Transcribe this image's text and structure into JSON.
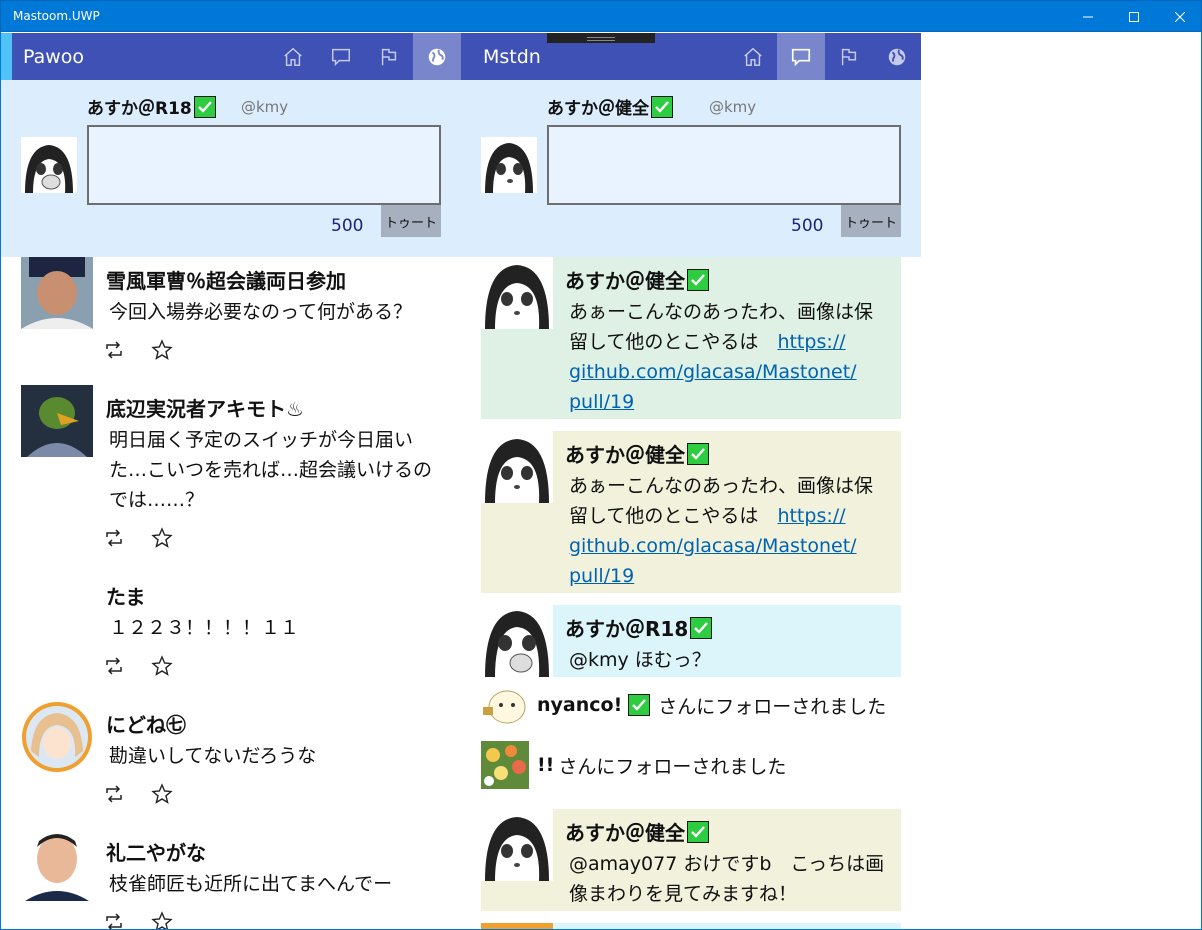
{
  "window": {
    "title": "Mastoom.UWP",
    "min_icon": "minimize-icon",
    "max_icon": "maximize-icon",
    "close_icon": "close-icon"
  },
  "columns": [
    {
      "name": "Pawoo",
      "accent_color": "#4fc3f7",
      "header_color": "#3f51b5",
      "active_tab": "globe",
      "compose": {
        "account": "あすか＠R18",
        "handle": "@kmy",
        "count": "500",
        "toot_label": "トゥート",
        "text": ""
      },
      "posts": [
        {
          "name": "雪風軍曹％超会議両日参加",
          "body": "今回入場券必要なのって何がある？"
        },
        {
          "name": "底辺実況者アキモト♨",
          "body": "明日届く予定のスイッチが今日届いた…こいつを売れば…超会議いけるのでは……？"
        },
        {
          "name": "たま",
          "body": "１２２３！！！！１１"
        },
        {
          "name": "にどね㊆",
          "body": "勘違いしてないだろうな"
        },
        {
          "name": "礼二やがな",
          "body": "枝雀師匠も近所に出てまへんでー"
        }
      ]
    },
    {
      "name": "Mstdn",
      "accent_color": "#3f51b5",
      "header_color": "#3f51b5",
      "active_tab": "chat",
      "compose": {
        "account": "あすか＠健全",
        "handle": "@kmy",
        "count": "500",
        "toot_label": "トゥート",
        "text": ""
      },
      "posts": [
        {
          "name": "あすか＠健全",
          "body_line1": "あぁーこんなのあったわ、画像は保",
          "body_line2": "留して他のとこやるは　",
          "link": "https://github.com/glacasa/Mastonet/pull/19",
          "link_l1": "https://",
          "link_l2": "github.com/glacasa/Mastonet/",
          "link_l3": "pull/19",
          "bg": "#dff0e4"
        },
        {
          "name": "あすか＠健全",
          "body_line1": "あぁーこんなのあったわ、画像は保",
          "body_line2": "留して他のとこやるは　",
          "link_l1": "https://",
          "link_l2": "github.com/glacasa/Mastonet/",
          "link_l3": "pull/19",
          "bg": "#f1f1dc"
        },
        {
          "name": "あすか＠R18",
          "body": "@kmy ほむっ？",
          "bg": "#dcf5fb"
        },
        {
          "name": "あすか＠健全",
          "body": "@amay077 おけですb　こっちは画像まわりを見てみますね！",
          "bg": "#f1f1dc"
        }
      ],
      "notices": [
        {
          "name": "nyanco!",
          "text": "さんにフォローされました"
        },
        {
          "name": "!!",
          "text": "さんにフォローされました"
        }
      ]
    }
  ]
}
